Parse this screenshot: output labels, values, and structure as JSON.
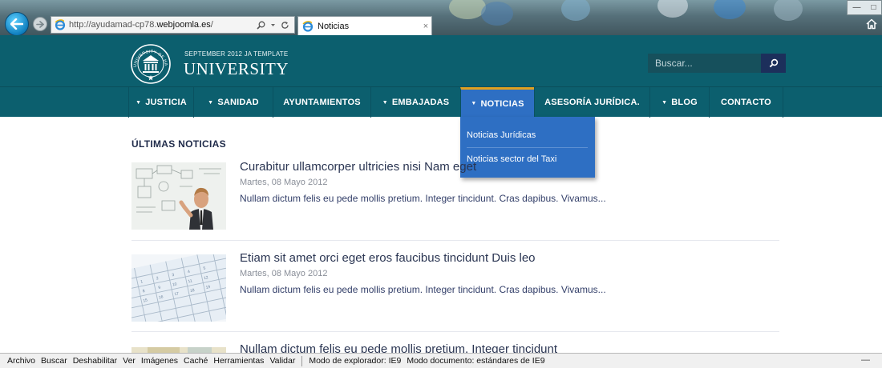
{
  "browser": {
    "address_prefix": "http://ayudamad-cp78.",
    "address_domain": "webjoomla.es",
    "address_suffix": "/",
    "tab_title": "Noticias",
    "tab_close": "×",
    "win_minimize": "—",
    "win_restore": "□"
  },
  "header": {
    "tagline": "SEPTEMBER  2012 JA TEMPLATE",
    "site_name": "UNIVERSITY",
    "seal_text": "UNIVERSITY OF HARVERSE",
    "search_placeholder": "Buscar..."
  },
  "nav": {
    "items": [
      {
        "label": "JUSTICIA",
        "has_caret": true
      },
      {
        "label": "SANIDAD",
        "has_caret": true
      },
      {
        "label": "AYUNTAMIENTOS",
        "has_caret": false
      },
      {
        "label": "EMBAJADAS",
        "has_caret": true
      },
      {
        "label": "NOTICIAS",
        "has_caret": true,
        "active": true
      },
      {
        "label": "ASESORÍA JURÍDICA.",
        "has_caret": false
      },
      {
        "label": "BLOG",
        "has_caret": true
      },
      {
        "label": "CONTACTO",
        "has_caret": false
      }
    ],
    "caret": "▼",
    "dropdown": [
      "Noticias Jurídicas",
      "Noticias sector del Taxi"
    ]
  },
  "content": {
    "section_title": "ÚLTIMAS NOTICIAS",
    "articles": [
      {
        "title": "Curabitur ullamcorper ultricies nisi Nam eget",
        "date": "Martes, 08 Mayo 2012",
        "excerpt": "Nullam dictum felis eu pede mollis pretium. Integer tincidunt. Cras dapibus. Vivamus..."
      },
      {
        "title": "Etiam sit amet orci eget eros faucibus tincidunt Duis leo",
        "date": "Martes, 08 Mayo 2012",
        "excerpt": "Nullam dictum felis eu pede mollis pretium. Integer tincidunt. Cras dapibus. Vivamus..."
      },
      {
        "title": "Nullam dictum felis eu pede mollis pretium. Integer tincidunt"
      }
    ]
  },
  "devbar": {
    "items": [
      "Archivo",
      "Buscar",
      "Deshabilitar",
      "Ver",
      "Imágenes",
      "Caché",
      "Herramientas",
      "Validar"
    ],
    "browser_mode": "Modo de explorador: IE9",
    "document_mode": "Modo documento:  estándares de IE9",
    "minimize": "—"
  },
  "colors": {
    "header_teal": "#0c5f6e",
    "nav_active_blue": "#2e6fc3",
    "active_accent": "#e0a020",
    "search_button": "#1c2f5b"
  }
}
